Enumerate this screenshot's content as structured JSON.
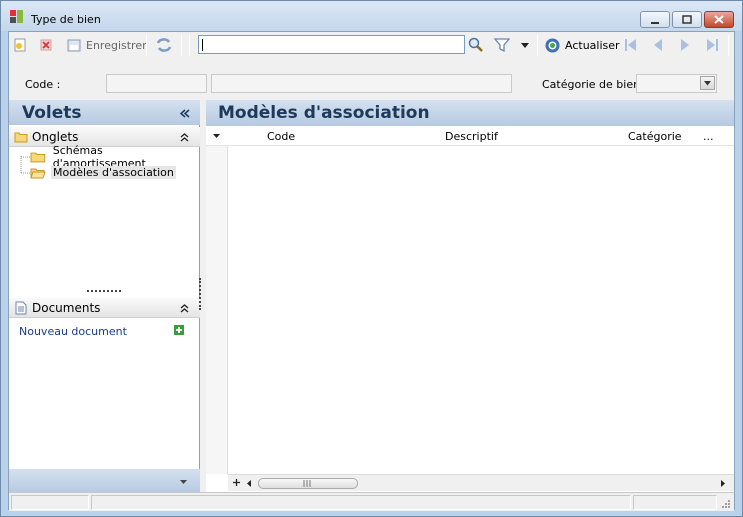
{
  "window": {
    "title": "Type de bien"
  },
  "toolbar": {
    "save_label": "Enregistrer",
    "refresh_label": "Actualiser",
    "search_value": ""
  },
  "filters": {
    "code_label": "Code :",
    "category_label": "Catégorie de bien :",
    "code_value": "",
    "description_value": "",
    "category_value": ""
  },
  "left_pane": {
    "title": "Volets",
    "tabs_section": {
      "title": "Onglets",
      "items": [
        {
          "label": "Schémas d'amortissement"
        },
        {
          "label": "Modèles d'association"
        }
      ]
    },
    "documents_section": {
      "title": "Documents",
      "new_document": "Nouveau document"
    }
  },
  "main": {
    "title": "Modèles d'association",
    "columns": [
      "Code",
      "Descriptif",
      "Catégorie",
      "..."
    ],
    "rows": []
  },
  "colors": {
    "header_text": "#1e3a5a",
    "link": "#1a3a8e",
    "accent": "#b6cae2"
  }
}
